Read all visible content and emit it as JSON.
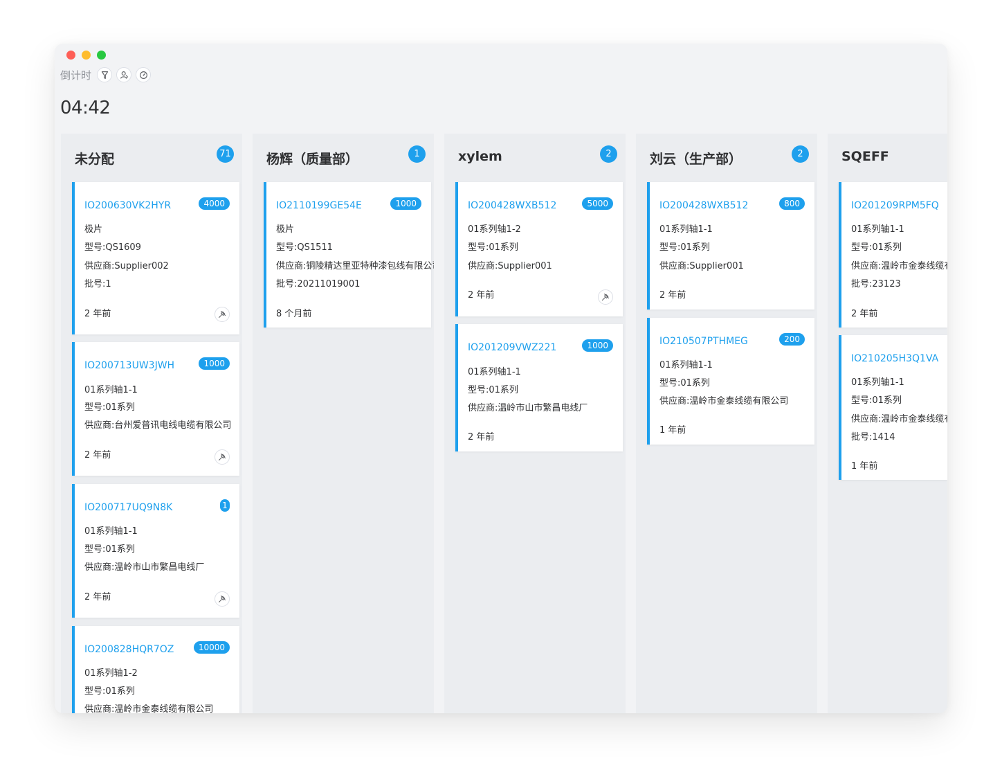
{
  "window": {
    "countdown_label": "倒计时",
    "timer": "04:42",
    "toolbar_icons": [
      "filter-icon",
      "user-swap-icon",
      "dashboard-icon"
    ]
  },
  "columns": [
    {
      "title": "未分配",
      "count": "71",
      "cards": [
        {
          "code": "IO200630VK2HYR",
          "qty": "4000",
          "lines": [
            "极片",
            "型号:QS1609",
            "供应商:Supplier002",
            "批号:1"
          ],
          "time": "2 年前",
          "pin": true
        },
        {
          "code": "IO200713UW3JWH",
          "qty": "1000",
          "lines": [
            "01系列轴1-1",
            "型号:01系列",
            "供应商:台州爱普讯电线电缆有限公司"
          ],
          "time": "2 年前",
          "pin": true
        },
        {
          "code": "IO200717UQ9N8K",
          "qty": "1",
          "lines": [
            "01系列轴1-1",
            "型号:01系列",
            "供应商:温岭市山市繁昌电线厂"
          ],
          "time": "2 年前",
          "pin": true
        },
        {
          "code": "IO200828HQR7OZ",
          "qty": "10000",
          "lines": [
            "01系列轴1-2",
            "型号:01系列",
            "供应商:温岭市金泰线缆有限公司"
          ],
          "time": "",
          "pin": false
        }
      ]
    },
    {
      "title": "杨辉（质量部）",
      "count": "1",
      "cards": [
        {
          "code": "IO2110199GE54E",
          "qty": "1000",
          "lines": [
            "极片",
            "型号:QS1511",
            "供应商:铜陵精达里亚特种漆包线有限公司",
            "批号:20211019001"
          ],
          "time": "8 个月前",
          "pin": false
        }
      ]
    },
    {
      "title": "xylem",
      "count": "2",
      "cards": [
        {
          "code": "IO200428WXB512",
          "qty": "5000",
          "lines": [
            "01系列轴1-2",
            "型号:01系列",
            "供应商:Supplier001"
          ],
          "time": "2 年前",
          "pin": true
        },
        {
          "code": "IO201209VWZ221",
          "qty": "1000",
          "lines": [
            "01系列轴1-1",
            "型号:01系列",
            "供应商:温岭市山市繁昌电线厂"
          ],
          "time": "2 年前",
          "pin": false
        }
      ]
    },
    {
      "title": "刘云（生产部）",
      "count": "2",
      "cards": [
        {
          "code": "IO200428WXB512",
          "qty": "800",
          "lines": [
            "01系列轴1-1",
            "型号:01系列",
            "供应商:Supplier001"
          ],
          "time": "2 年前",
          "pin": false
        },
        {
          "code": "IO210507PTHMEG",
          "qty": "200",
          "lines": [
            "01系列轴1-1",
            "型号:01系列",
            "供应商:温岭市金泰线缆有限公司"
          ],
          "time": "1 年前",
          "pin": false
        }
      ]
    },
    {
      "title": "SQEFF",
      "count": "",
      "cards": [
        {
          "code": "IO201209RPM5FQ",
          "qty": "",
          "lines": [
            "01系列轴1-1",
            "型号:01系列",
            "供应商:温岭市金泰线缆有限公司",
            "批号:23123"
          ],
          "time": "2 年前",
          "pin": false
        },
        {
          "code": "IO210205H3Q1VA",
          "qty": "",
          "lines": [
            "01系列轴1-1",
            "型号:01系列",
            "供应商:温岭市金泰线缆有限公司",
            "批号:1414"
          ],
          "time": "1 年前",
          "pin": false
        }
      ]
    }
  ]
}
